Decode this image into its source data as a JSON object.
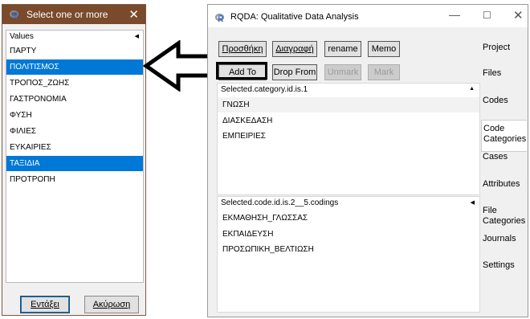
{
  "dialog": {
    "title": "Select one or more",
    "header": "Values",
    "items": [
      {
        "label": "ΠΑΡΤΥ",
        "selected": false
      },
      {
        "label": "ΠΟΛΙΤΙΣΜΟΣ",
        "selected": true
      },
      {
        "label": "ΤΡΟΠΟΣ_ΖΩΗΣ",
        "selected": false
      },
      {
        "label": "ΓΑΣΤΡΟΝΟΜΙΑ",
        "selected": false
      },
      {
        "label": "ΦΥΣΗ",
        "selected": false
      },
      {
        "label": "ΦΙΛΙΕΣ",
        "selected": false
      },
      {
        "label": "ΕΥΚΑΙΡΙΕΣ",
        "selected": false
      },
      {
        "label": "ΤΑΞΙΔΙΑ",
        "selected": true
      },
      {
        "label": "ΠΡΟΤΡΟΠΗ",
        "selected": false
      }
    ],
    "ok_label": "Εντάξει",
    "cancel_label": "Ακύρωση",
    "selection_color": "#0078d7",
    "title_bar_color": "#7a4a2c"
  },
  "window": {
    "title": "RQDA: Qualitative Data Analysis",
    "toolbar_row1": {
      "add": "Προσθήκη",
      "delete": "Διαγραφή",
      "rename": "rename",
      "memo": "Memo"
    },
    "toolbar_row2": {
      "add_to": "Add To",
      "drop_from": "Drop From",
      "unmark": "Unmark",
      "mark": "Mark"
    },
    "panel1": {
      "header": "Selected.category.id.is.1",
      "items": [
        "ΓΝΩΣΗ",
        "ΔΙΑΣΚΕΔΑΣΗ",
        "ΕΜΠΕΙΡΙΕΣ"
      ]
    },
    "panel2": {
      "header": "Selected.code.id.is.2__5.codings",
      "items": [
        "ΕΚΜΑΘΗΣΗ_ΓΛΩΣΣΑΣ",
        "ΕΚΠΑΙΔΕΥΣΗ",
        "ΠΡΟΣΩΠΙΚΗ_ΒΕΛΤΙΩΣΗ"
      ]
    },
    "tabs": [
      {
        "label": "Project",
        "active": false
      },
      {
        "label": "Files",
        "active": false
      },
      {
        "label": "Codes",
        "active": false
      },
      {
        "label": "Code Categories",
        "active": true
      },
      {
        "label": "Cases",
        "active": false
      },
      {
        "label": "Attributes",
        "active": false
      },
      {
        "label": "File Categories",
        "active": false
      },
      {
        "label": "Journals",
        "active": false
      },
      {
        "label": "Settings",
        "active": false
      }
    ]
  }
}
